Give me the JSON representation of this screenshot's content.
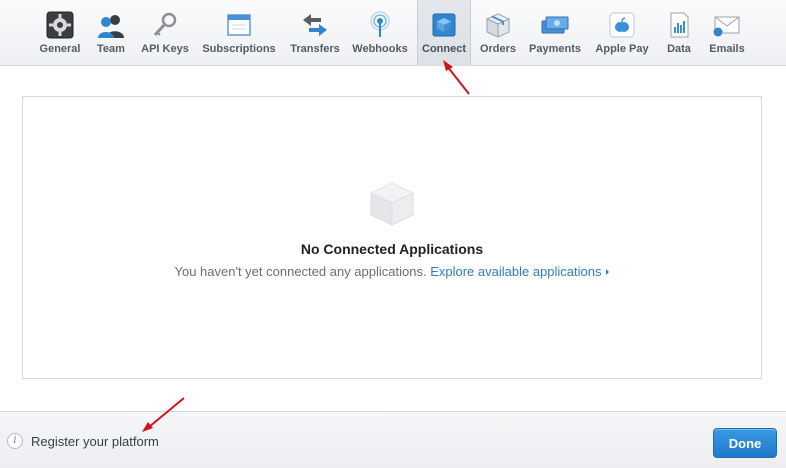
{
  "toolbar": {
    "tabs": [
      {
        "label": "General",
        "icon": "gear-icon"
      },
      {
        "label": "Team",
        "icon": "team-icon"
      },
      {
        "label": "API Keys",
        "icon": "key-icon"
      },
      {
        "label": "Subscriptions",
        "icon": "window-icon"
      },
      {
        "label": "Transfers",
        "icon": "transfer-arrows-icon"
      },
      {
        "label": "Webhooks",
        "icon": "antenna-icon"
      },
      {
        "label": "Connect",
        "icon": "cube-icon",
        "active": true
      },
      {
        "label": "Orders",
        "icon": "box-icon"
      },
      {
        "label": "Payments",
        "icon": "money-icon"
      },
      {
        "label": "Apple Pay",
        "icon": "apple-icon"
      },
      {
        "label": "Data",
        "icon": "chart-document-icon"
      },
      {
        "label": "Emails",
        "icon": "envelope-icon"
      }
    ]
  },
  "main": {
    "empty_title": "No Connected Applications",
    "empty_text": "You haven't yet connected any applications.",
    "explore_link": "Explore available applications"
  },
  "footer": {
    "register_link": "Register your platform",
    "done_label": "Done"
  },
  "colors": {
    "accent": "#2e7ec6",
    "button": "#2a88d8",
    "annotation_arrow": "#d0141c"
  }
}
